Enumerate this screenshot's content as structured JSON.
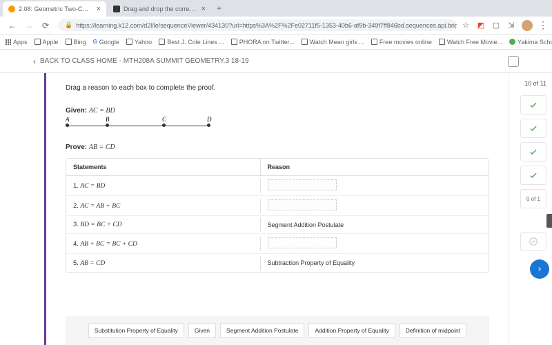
{
  "browser": {
    "tabs": [
      {
        "title": "2.08: Geometric Two-Column",
        "active": true
      },
      {
        "title": "Drag and drop the correct ans",
        "active": false
      }
    ],
    "url": "https://learning.k12.com/d2l/le/sequenceViewer/434130?url=https%3A%2F%2Fe02711f5-1353-40b6-af9b-349f7ff846bd.sequences.api.brightspace.com%2F434...",
    "bookmarks": [
      "Apps",
      "Apple",
      "Bing",
      "Google",
      "Yahoo",
      "Best J. Cole Lines ...",
      "PHORA on Twitter...",
      "Watch Mean girls ...",
      "Free movies online",
      "Watch Free Movie...",
      "Yakima School Dis..."
    ]
  },
  "header": {
    "back_text": "BACK TO CLASS HOME - MTH208A SUMMIT GEOMETRY.3 18-19"
  },
  "lesson": {
    "instruction": "Drag a reason to each box to complete the proof.",
    "given_prefix": "Given: ",
    "given_math": "AC = BD",
    "points": [
      "A",
      "B",
      "C",
      "D"
    ],
    "prove_prefix": "Prove: ",
    "prove_math": "AB = CD",
    "table_headers": {
      "statements": "Statements",
      "reason": "Reason"
    },
    "rows": [
      {
        "num": "1.",
        "stmt": "AC = BD",
        "reason": ""
      },
      {
        "num": "2.",
        "stmt": "AC = AB + BC",
        "reason": ""
      },
      {
        "num": "3.",
        "stmt": "BD = BC + CD",
        "reason": "Segment Addition Postulate"
      },
      {
        "num": "4.",
        "stmt": "AB + BC = BC + CD",
        "reason": ""
      },
      {
        "num": "5.",
        "stmt": "AB = CD",
        "reason": "Subtraction Property of Equality"
      }
    ],
    "answers": [
      "Substitution Property of Equality",
      "Given",
      "Segment Addition Postulate",
      "Addition Property of Equality",
      "Definition of midpoint"
    ]
  },
  "rail": {
    "progress": "10 of 11",
    "score": "0 of 1"
  }
}
